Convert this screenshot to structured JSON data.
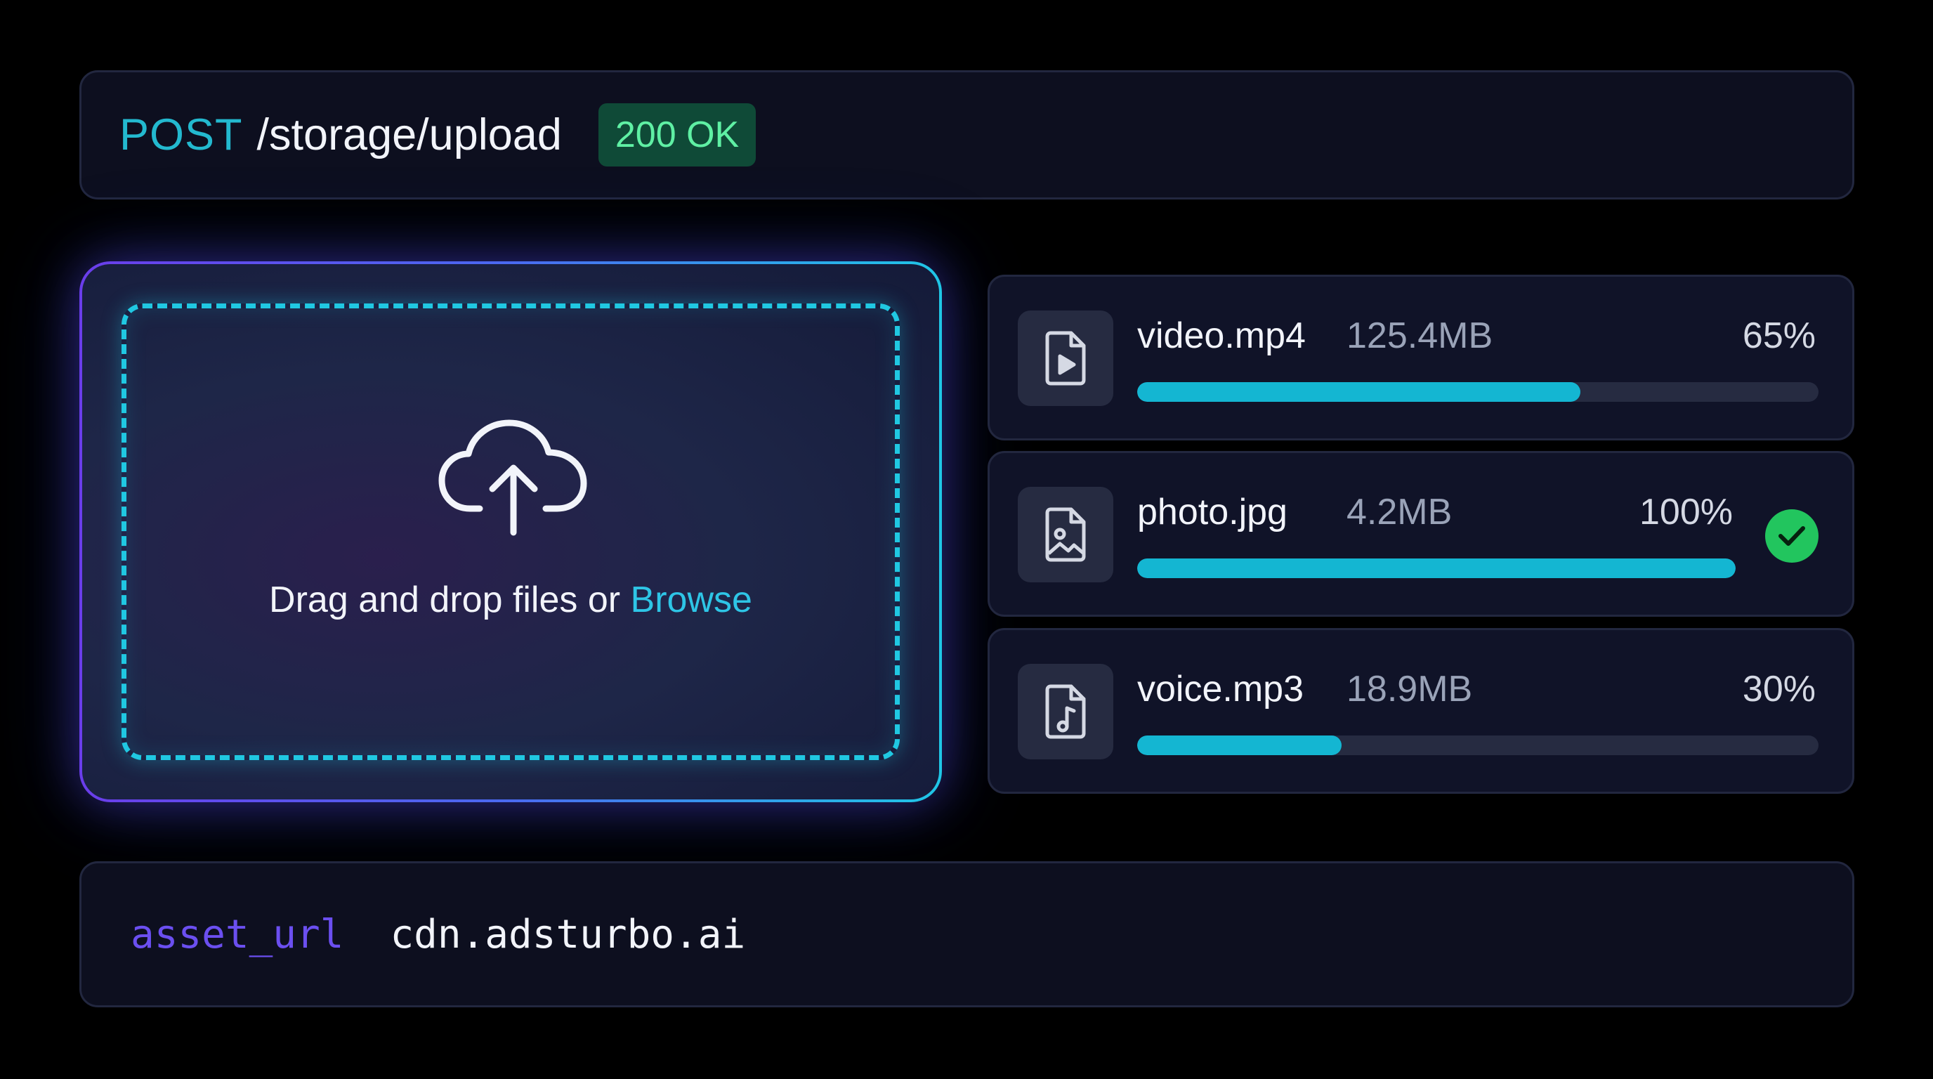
{
  "endpoint": {
    "method": "POST",
    "path": "/storage/upload",
    "status": "200 OK"
  },
  "dropzone": {
    "icon": "upload-cloud-icon",
    "text": "Drag and drop files or ",
    "browse_label": "Browse"
  },
  "files": [
    {
      "name": "video.mp4",
      "size": "125.4MB",
      "percent_label": "65%",
      "progress": 0.65,
      "icon": "file-video-icon",
      "complete": false
    },
    {
      "name": "photo.jpg",
      "size": "4.2MB",
      "percent_label": "100%",
      "progress": 1.0,
      "icon": "file-image-icon",
      "complete": true
    },
    {
      "name": "voice.mp3",
      "size": "18.9MB",
      "percent_label": "30%",
      "progress": 0.3,
      "icon": "file-audio-icon",
      "complete": false
    }
  ],
  "asset": {
    "key": "asset_url",
    "value": "cdn.adsturbo.ai"
  },
  "colors": {
    "accent_cyan": "#14b6d2",
    "status_green": "#5ff0a4",
    "check_green": "#22c55e",
    "key_purple": "#6b4ff0"
  }
}
